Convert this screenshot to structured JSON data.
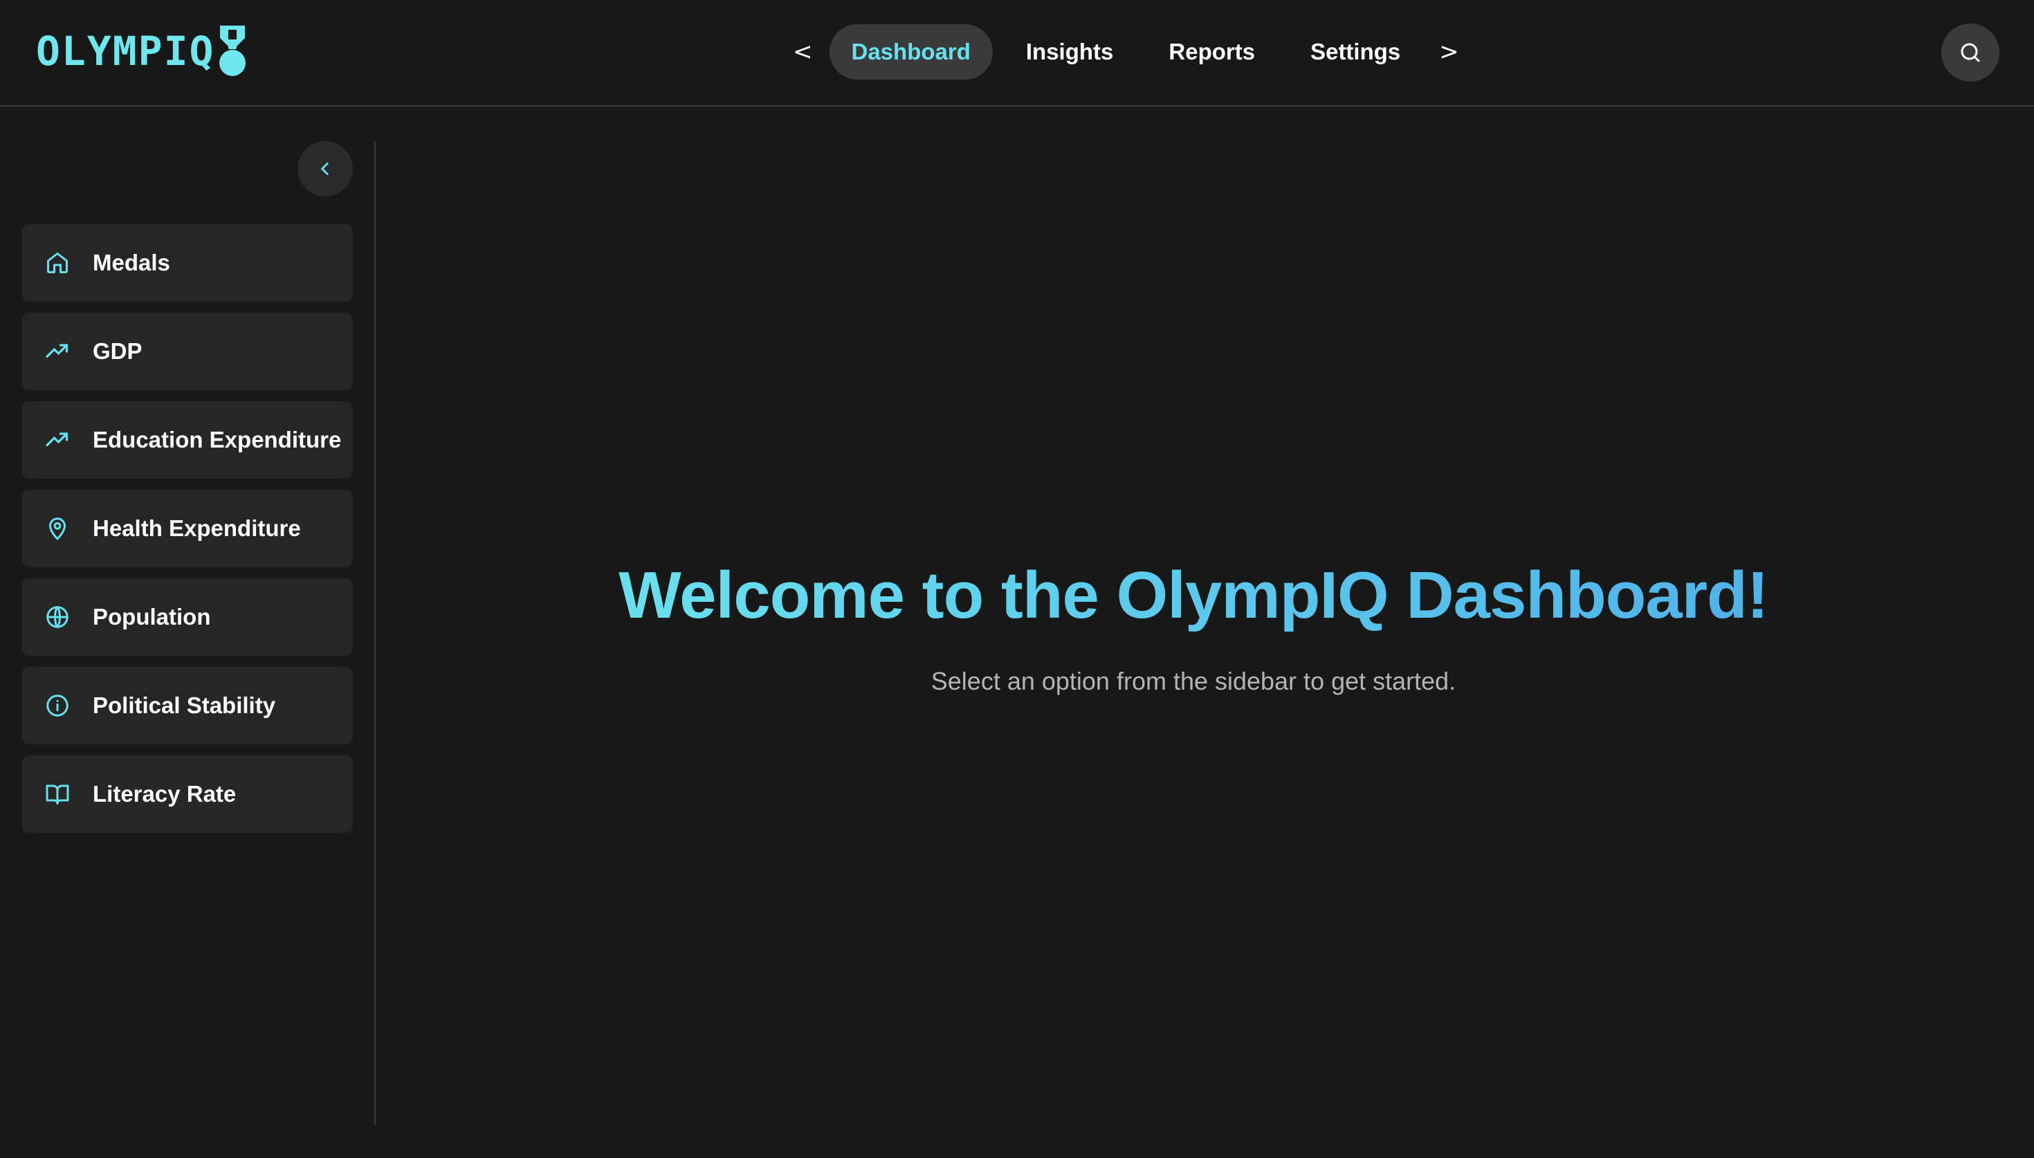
{
  "app": {
    "logo_text": "OLYMPIQ",
    "accent_color": "#67e1ef"
  },
  "header": {
    "prev_arrow": "<",
    "next_arrow": ">",
    "tabs": [
      {
        "label": "Dashboard",
        "active": true
      },
      {
        "label": "Insights",
        "active": false
      },
      {
        "label": "Reports",
        "active": false
      },
      {
        "label": "Settings",
        "active": false
      }
    ],
    "search_icon": "search-icon"
  },
  "sidebar": {
    "collapse_icon": "chevron-left-icon",
    "items": [
      {
        "label": "Medals",
        "icon": "home-icon"
      },
      {
        "label": "GDP",
        "icon": "trending-up-icon"
      },
      {
        "label": "Education Expenditure",
        "icon": "trending-up-icon"
      },
      {
        "label": "Health Expenditure",
        "icon": "map-pin-icon"
      },
      {
        "label": "Population",
        "icon": "globe-icon"
      },
      {
        "label": "Political Stability",
        "icon": "info-icon"
      },
      {
        "label": "Literacy Rate",
        "icon": "book-open-icon"
      }
    ]
  },
  "main": {
    "title": "Welcome to the OlympIQ Dashboard!",
    "subtitle": "Select an option from the sidebar to get started."
  }
}
